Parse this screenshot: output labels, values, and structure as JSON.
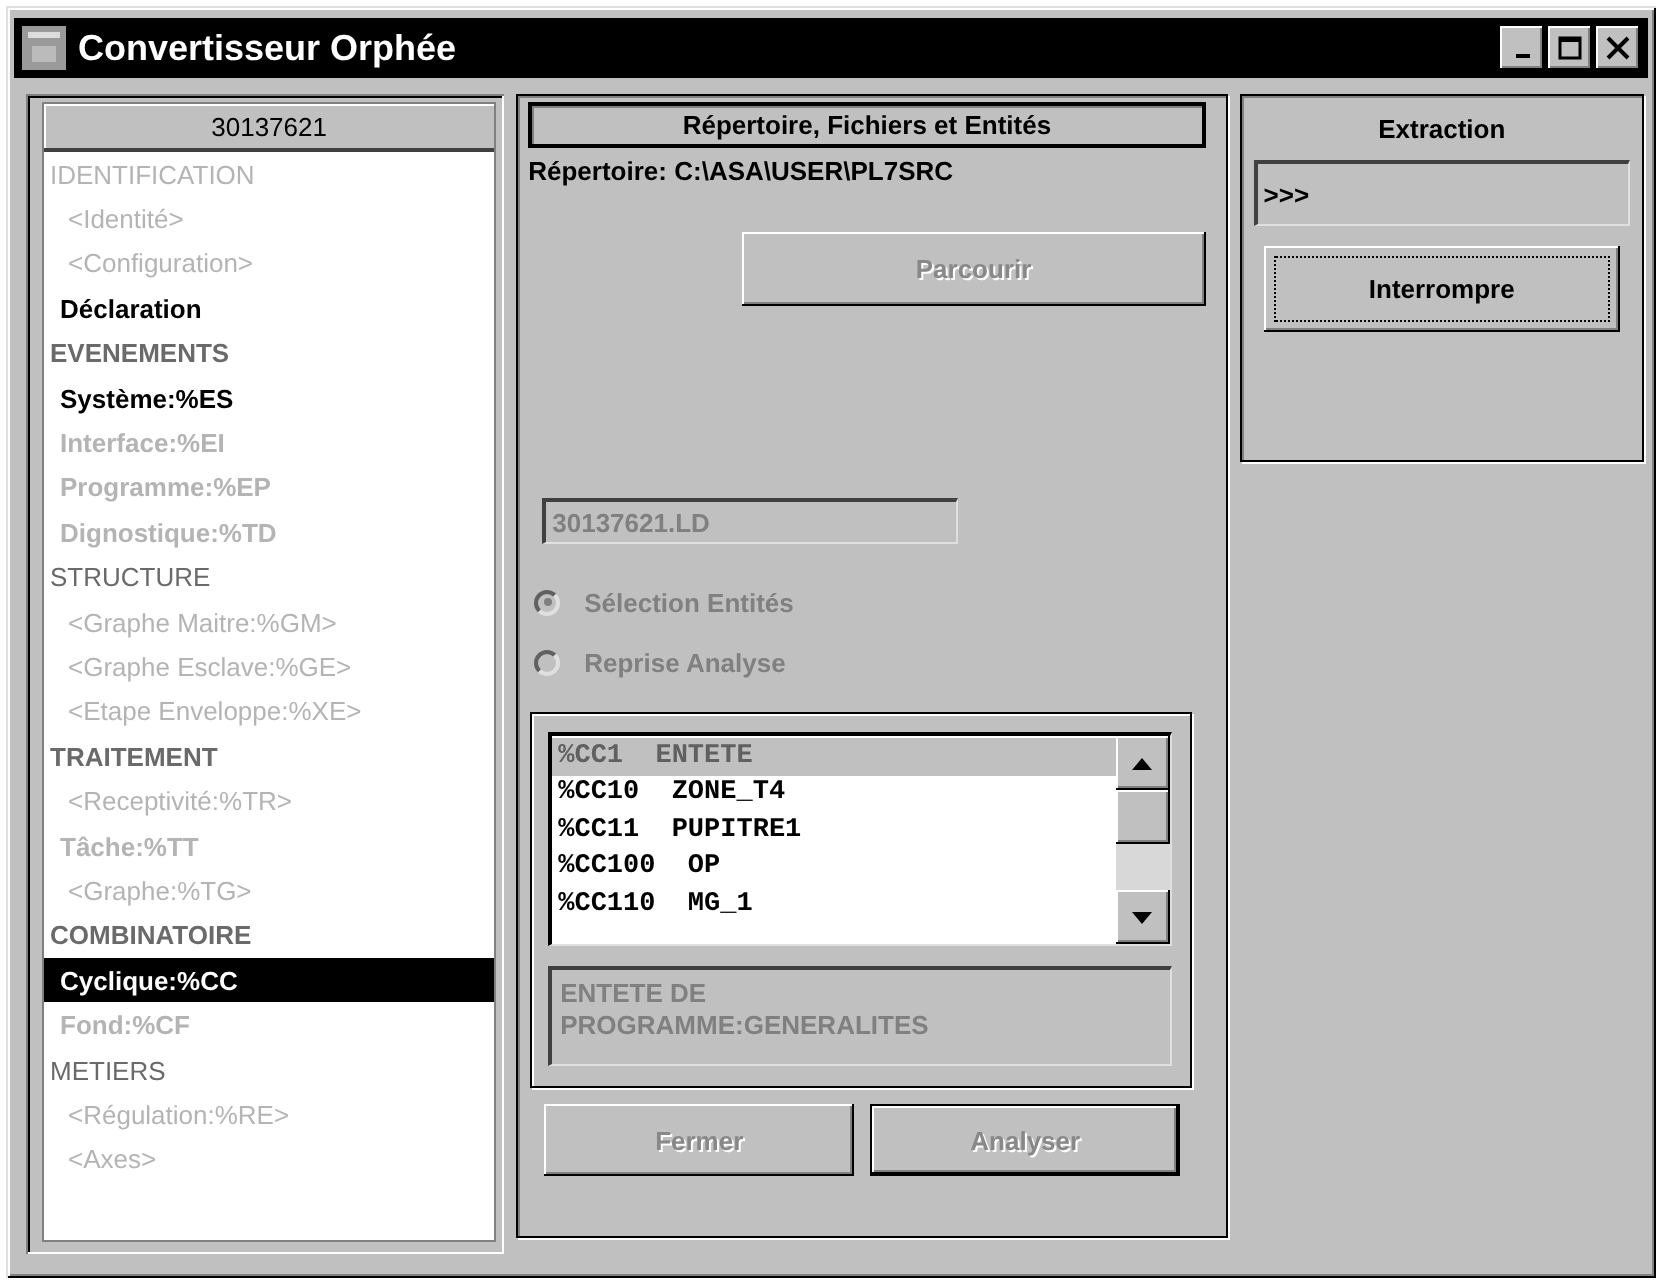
{
  "window": {
    "title": "Convertisseur Orphée"
  },
  "tree": {
    "header": "30137621",
    "items": [
      {
        "label": "IDENTIFICATION",
        "bold": false,
        "disabled": true,
        "selected": false,
        "children": [
          {
            "label": "<Identité>",
            "bold": false,
            "disabled": true,
            "selected": false
          },
          {
            "label": "<Configuration>",
            "bold": false,
            "disabled": true,
            "selected": false
          },
          {
            "label": "Déclaration",
            "bold": true,
            "disabled": false,
            "selected": false
          }
        ]
      },
      {
        "label": "EVENEMENTS",
        "bold": true,
        "disabled": false,
        "selected": false,
        "children": [
          {
            "label": "Système:%ES",
            "bold": true,
            "disabled": false,
            "selected": false
          },
          {
            "label": "Interface:%EI",
            "bold": true,
            "disabled": true,
            "selected": false
          },
          {
            "label": "Programme:%EP",
            "bold": true,
            "disabled": true,
            "selected": false
          },
          {
            "label": "Dignostique:%TD",
            "bold": true,
            "disabled": true,
            "selected": false
          }
        ]
      },
      {
        "label": "STRUCTURE",
        "bold": false,
        "disabled": false,
        "selected": false,
        "children": [
          {
            "label": "<Graphe Maitre:%GM>",
            "bold": false,
            "disabled": true,
            "selected": false
          },
          {
            "label": "<Graphe Esclave:%GE>",
            "bold": false,
            "disabled": true,
            "selected": false
          },
          {
            "label": "<Etape Enveloppe:%XE>",
            "bold": false,
            "disabled": true,
            "selected": false
          }
        ]
      },
      {
        "label": "TRAITEMENT",
        "bold": true,
        "disabled": false,
        "selected": false,
        "children": [
          {
            "label": "<Receptivité:%TR>",
            "bold": false,
            "disabled": true,
            "selected": false
          },
          {
            "label": "Tâche:%TT",
            "bold": true,
            "disabled": true,
            "selected": false
          },
          {
            "label": "<Graphe:%TG>",
            "bold": false,
            "disabled": true,
            "selected": false
          }
        ]
      },
      {
        "label": "COMBINATOIRE",
        "bold": true,
        "disabled": false,
        "selected": false,
        "children": [
          {
            "label": "Cyclique:%CC",
            "bold": true,
            "disabled": false,
            "selected": true
          },
          {
            "label": "Fond:%CF",
            "bold": true,
            "disabled": true,
            "selected": false
          }
        ]
      },
      {
        "label": "METIERS",
        "bold": false,
        "disabled": false,
        "selected": false,
        "children": [
          {
            "label": "<Régulation:%RE>",
            "bold": false,
            "disabled": true,
            "selected": false
          },
          {
            "label": "<Axes>",
            "bold": false,
            "disabled": true,
            "selected": false
          }
        ]
      }
    ]
  },
  "files": {
    "title": "Répertoire, Fichiers et Entités",
    "directory_label": "Répertoire:",
    "directory": "C:\\ASA\\USER\\PL7SRC",
    "browse_button": {
      "label": "Parcourir",
      "disabled": true
    },
    "file_field": {
      "value": "30137621.LD",
      "disabled": true
    },
    "radios": [
      {
        "label": "Sélection Entités",
        "selected": true,
        "disabled": true
      },
      {
        "label": "Reprise Analyse",
        "selected": false,
        "disabled": true
      }
    ],
    "entities": [
      {
        "label": "%CC1  ENTETE",
        "selected": true
      },
      {
        "label": "%CC10  ZONE_T4",
        "selected": false
      },
      {
        "label": "%CC11  PUPITRE1",
        "selected": false
      },
      {
        "label": "%CC100  OP",
        "selected": false
      },
      {
        "label": "%CC110  MG_1",
        "selected": false
      }
    ],
    "description": "ENTETE DE PROGRAMME:GENERALITES",
    "buttons": [
      {
        "label": "Fermer",
        "disabled": true,
        "default": false
      },
      {
        "label": "Analyser",
        "disabled": true,
        "default": true
      }
    ]
  },
  "extraction": {
    "title": "Extraction",
    "value": ">>>",
    "button": {
      "label": "Interrompre",
      "disabled": false,
      "focused": true
    }
  }
}
